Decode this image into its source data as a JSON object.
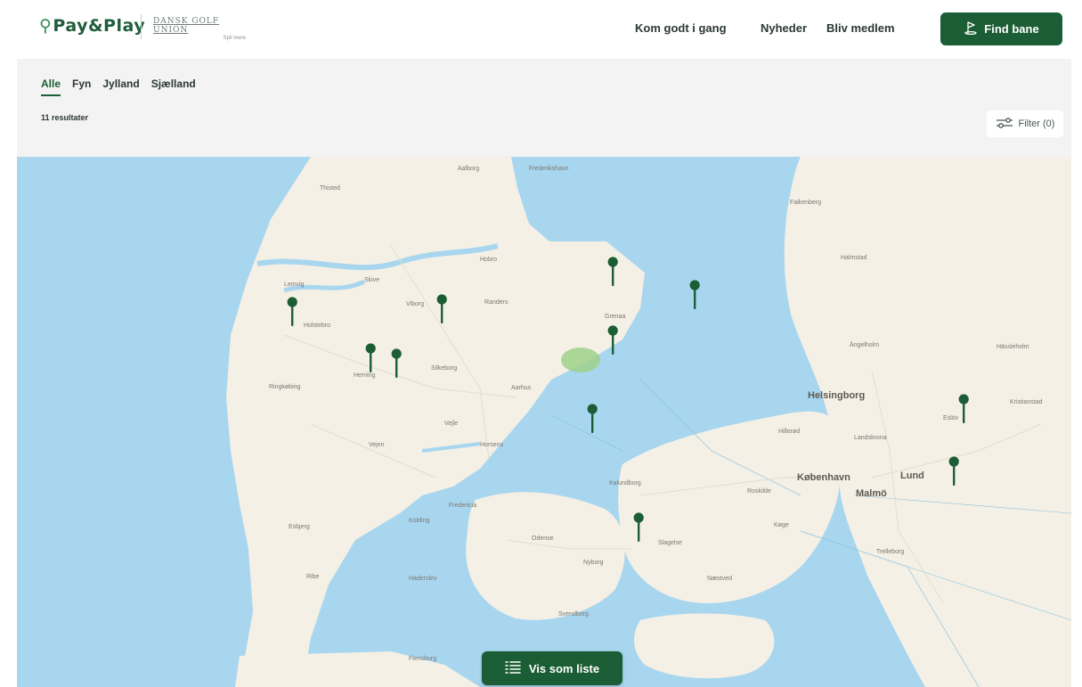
{
  "header": {
    "logo_text": "Pay&Play",
    "partner_name": "DANSK GOLF UNION",
    "partner_sub": "Spil mere",
    "nav": [
      "Kom godt i gang",
      "Nyheder",
      "Bliv medlem"
    ],
    "find_button": "Find bane",
    "find_icon": "golf-flag-icon"
  },
  "filters": {
    "tabs": [
      "Alle",
      "Fyn",
      "Jylland",
      "Sjælland"
    ],
    "active_tab": "Alle",
    "result_count": "11 resultater",
    "filter_button": "Filter (0)",
    "filter_icon": "sliders-icon"
  },
  "map": {
    "labels": {
      "major": [
        "Helsingborg",
        "København",
        "Malmö",
        "Lund"
      ],
      "minor": [
        "Aalborg",
        "Thisted",
        "Randers",
        "Viborg",
        "Silkeborg",
        "Aarhus",
        "Holstebro",
        "Herning",
        "Skive",
        "Esbjerg",
        "Vejle",
        "Fredericia",
        "Kolding",
        "Odense",
        "Nyborg",
        "Svendborg",
        "Haderslev",
        "Grenaa",
        "Hillerød",
        "Roskilde",
        "Køge",
        "Slagelse",
        "Næstved",
        "Kalundborg",
        "Trelleborg",
        "Landskrona",
        "Falkenberg",
        "Halmstad",
        "Ängelholm",
        "Kristianstad",
        "Hässleholm",
        "Eslöv",
        "Flensburg",
        "Horsens",
        "Ribe",
        "Vejen",
        "Ringkøbing",
        "Lemvig",
        "Hobro",
        "Frederikshavn"
      ]
    },
    "markers": [
      {
        "name": "course-marker-1",
        "lng_x": 0.5652,
        "lat_y": 0.2375
      },
      {
        "name": "course-marker-2",
        "lng_x": 0.6427,
        "lat_y": 0.2811
      },
      {
        "name": "course-marker-3",
        "lng_x": 0.261,
        "lat_y": 0.313
      },
      {
        "name": "course-marker-4",
        "lng_x": 0.4029,
        "lat_y": 0.308
      },
      {
        "name": "course-marker-5",
        "lng_x": 0.5647,
        "lat_y": 0.3668
      },
      {
        "name": "course-marker-6",
        "lng_x": 0.335,
        "lat_y": 0.4
      },
      {
        "name": "course-marker-7",
        "lng_x": 0.3595,
        "lat_y": 0.4101
      },
      {
        "name": "course-marker-8",
        "lng_x": 0.5453,
        "lat_y": 0.5143
      },
      {
        "name": "course-marker-9",
        "lng_x": 0.8978,
        "lat_y": 0.4959
      },
      {
        "name": "course-marker-10",
        "lng_x": 0.8885,
        "lat_y": 0.6134
      },
      {
        "name": "course-marker-11",
        "lng_x": 0.5892,
        "lat_y": 0.7193
      }
    ],
    "marker_color": "#1b5e35",
    "list_button": "Vis som liste",
    "list_icon": "list-icon"
  },
  "colors": {
    "brand_green": "#1b5e35",
    "water": "#a8d6ef",
    "land": "#f4f0e6",
    "park": "#9fd08a"
  }
}
